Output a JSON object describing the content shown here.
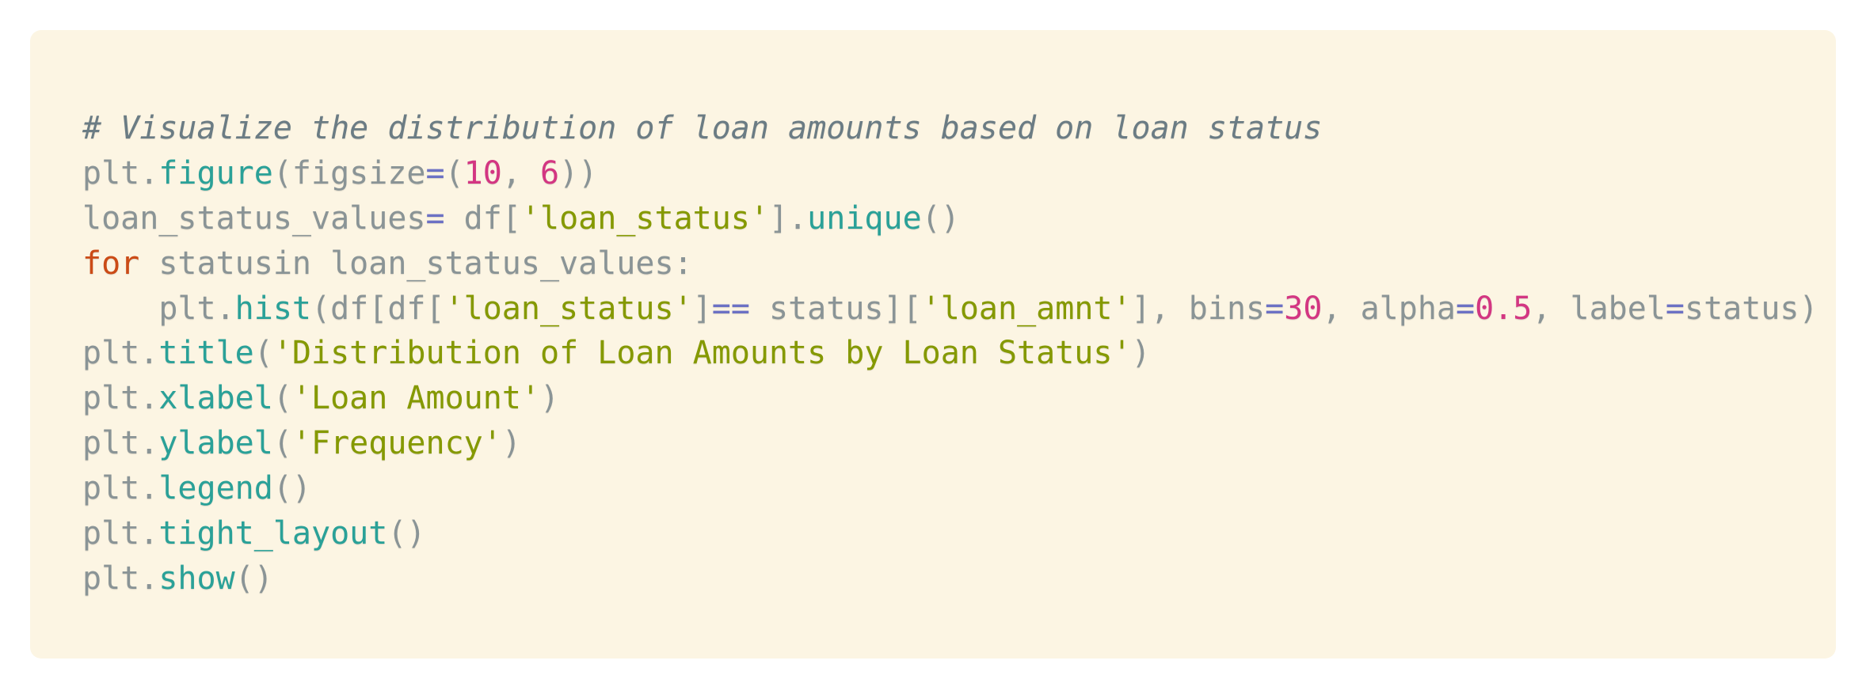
{
  "code": {
    "language": "python",
    "colors": {
      "background": "#fcf5e3",
      "comment": "#6b7c84",
      "function": "#2aa198",
      "string": "#859900",
      "number": "#d33682",
      "keyword": "#cb4b16",
      "operator": "#6c71c4",
      "identifier": "#8a9496"
    },
    "lines": [
      [
        {
          "t": "comment",
          "v": "# Visualize the distribution of loan amounts based on loan status"
        }
      ],
      [
        {
          "t": "id",
          "v": "plt."
        },
        {
          "t": "fn",
          "v": "figure"
        },
        {
          "t": "punc",
          "v": "(figsize"
        },
        {
          "t": "op",
          "v": "="
        },
        {
          "t": "punc",
          "v": "("
        },
        {
          "t": "num",
          "v": "10"
        },
        {
          "t": "punc",
          "v": ", "
        },
        {
          "t": "num",
          "v": "6"
        },
        {
          "t": "punc",
          "v": "))"
        }
      ],
      [
        {
          "t": "id",
          "v": "loan_status_values"
        },
        {
          "t": "op",
          "v": "="
        },
        {
          "t": "id",
          "v": " df["
        },
        {
          "t": "str",
          "v": "'loan_status'"
        },
        {
          "t": "punc",
          "v": "]."
        },
        {
          "t": "fn",
          "v": "unique"
        },
        {
          "t": "punc",
          "v": "()"
        }
      ],
      [
        {
          "t": "kw",
          "v": "for"
        },
        {
          "t": "id",
          "v": " statusin loan_status_values:"
        }
      ],
      [
        {
          "t": "id",
          "v": "    plt."
        },
        {
          "t": "fn",
          "v": "hist"
        },
        {
          "t": "punc",
          "v": "(df[df["
        },
        {
          "t": "str",
          "v": "'loan_status'"
        },
        {
          "t": "punc",
          "v": "]"
        },
        {
          "t": "op",
          "v": "=="
        },
        {
          "t": "id",
          "v": " status]["
        },
        {
          "t": "str",
          "v": "'loan_amnt'"
        },
        {
          "t": "punc",
          "v": "], bins"
        },
        {
          "t": "op",
          "v": "="
        },
        {
          "t": "num",
          "v": "30"
        },
        {
          "t": "punc",
          "v": ", alpha"
        },
        {
          "t": "op",
          "v": "="
        },
        {
          "t": "num",
          "v": "0.5"
        },
        {
          "t": "punc",
          "v": ", label"
        },
        {
          "t": "op",
          "v": "="
        },
        {
          "t": "id",
          "v": "status)"
        }
      ],
      [
        {
          "t": "id",
          "v": "plt."
        },
        {
          "t": "fn",
          "v": "title"
        },
        {
          "t": "punc",
          "v": "("
        },
        {
          "t": "str",
          "v": "'Distribution of Loan Amounts by Loan Status'"
        },
        {
          "t": "punc",
          "v": ")"
        }
      ],
      [
        {
          "t": "id",
          "v": "plt."
        },
        {
          "t": "fn",
          "v": "xlabel"
        },
        {
          "t": "punc",
          "v": "("
        },
        {
          "t": "str",
          "v": "'Loan Amount'"
        },
        {
          "t": "punc",
          "v": ")"
        }
      ],
      [
        {
          "t": "id",
          "v": "plt."
        },
        {
          "t": "fn",
          "v": "ylabel"
        },
        {
          "t": "punc",
          "v": "("
        },
        {
          "t": "str",
          "v": "'Frequency'"
        },
        {
          "t": "punc",
          "v": ")"
        }
      ],
      [
        {
          "t": "id",
          "v": "plt."
        },
        {
          "t": "fn",
          "v": "legend"
        },
        {
          "t": "punc",
          "v": "()"
        }
      ],
      [
        {
          "t": "id",
          "v": "plt."
        },
        {
          "t": "fn",
          "v": "tight_layout"
        },
        {
          "t": "punc",
          "v": "()"
        }
      ],
      [
        {
          "t": "id",
          "v": "plt."
        },
        {
          "t": "fn",
          "v": "show"
        },
        {
          "t": "punc",
          "v": "()"
        }
      ]
    ]
  }
}
